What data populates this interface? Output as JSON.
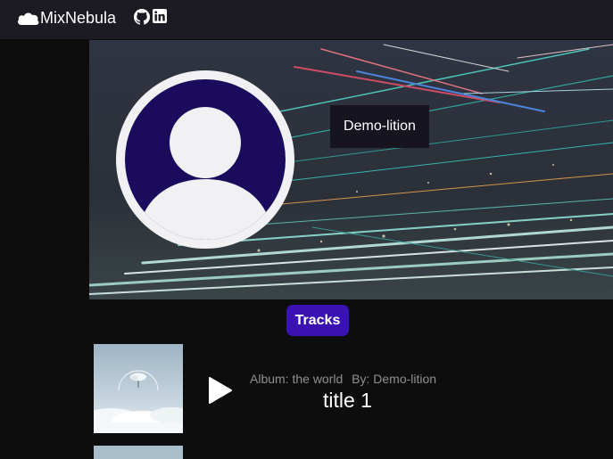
{
  "navbar": {
    "brand": "MixNebula",
    "brand_icon": "cloud-icon",
    "links": [
      {
        "icon": "github-icon"
      },
      {
        "icon": "linkedin-icon"
      }
    ]
  },
  "profile": {
    "artist_name": "Demo-lition",
    "avatar_icon": "user-avatar-icon"
  },
  "tabs": {
    "active": "Tracks"
  },
  "tracks": [
    {
      "album_label": "Album: the world",
      "by_label": "By: Demo-lition",
      "title": "title 1"
    }
  ],
  "colors": {
    "navbar_bg": "#1c1b24",
    "page_bg": "#0d0d0d",
    "accent": "#3a12b4",
    "avatar_bg": "#1a0b5c"
  }
}
